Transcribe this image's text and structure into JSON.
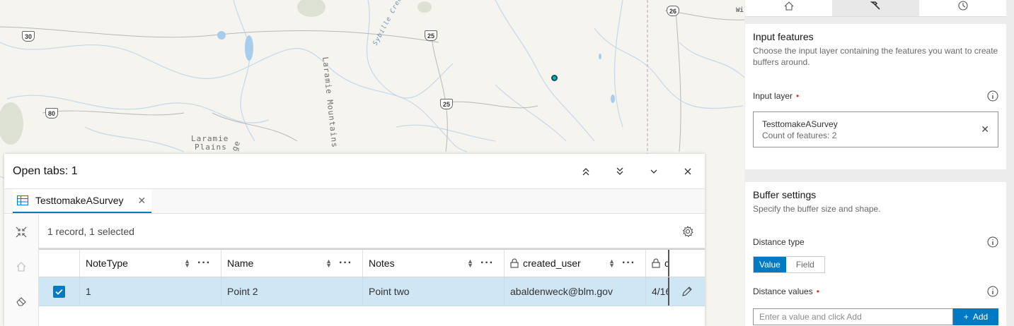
{
  "map": {
    "labels": {
      "laramie_mountains": "Laramie Mountains",
      "laramie_plains_1": "Laramie",
      "laramie_plains_2": "Plains",
      "range_fragment": "ge",
      "sybille_creek": "Sybille Creek",
      "wi_fragment": "Wi"
    },
    "shields": {
      "r30": "30",
      "r80": "80",
      "r25a": "25",
      "r25b": "25",
      "r26": "26"
    },
    "point_color": "#00b7c3"
  },
  "table_panel": {
    "title": "Open tabs: 1",
    "tab_label": "TesttomakeASurvey",
    "records_text": "1 record, 1 selected",
    "columns": [
      "NoteType",
      "Name",
      "Notes",
      "created_user",
      "c"
    ],
    "rows": [
      {
        "NoteType": "1",
        "Name": "Point 2",
        "Notes": "Point two",
        "created_user": "abaldenweck@blm.gov",
        "c": "4/16"
      }
    ]
  },
  "right_panel": {
    "input_features": {
      "heading": "Input features",
      "description": "Choose the input layer containing the features you want to create buffers around.",
      "input_layer_label": "Input layer",
      "required_mark": "•",
      "layer_name": "TesttomakeASurvey",
      "layer_count": "Count of features: 2"
    },
    "buffer_settings": {
      "heading": "Buffer settings",
      "description": "Specify the buffer size and shape.",
      "distance_type_label": "Distance type",
      "option_value": "Value",
      "option_field": "Field",
      "distance_values_label": "Distance values",
      "required_mark": "•",
      "input_placeholder": "Enter a value and click Add",
      "add_label": "Add"
    }
  },
  "colors": {
    "accent": "#007ac2",
    "selected_row": "#cfe6f5",
    "required": "#d83020"
  }
}
